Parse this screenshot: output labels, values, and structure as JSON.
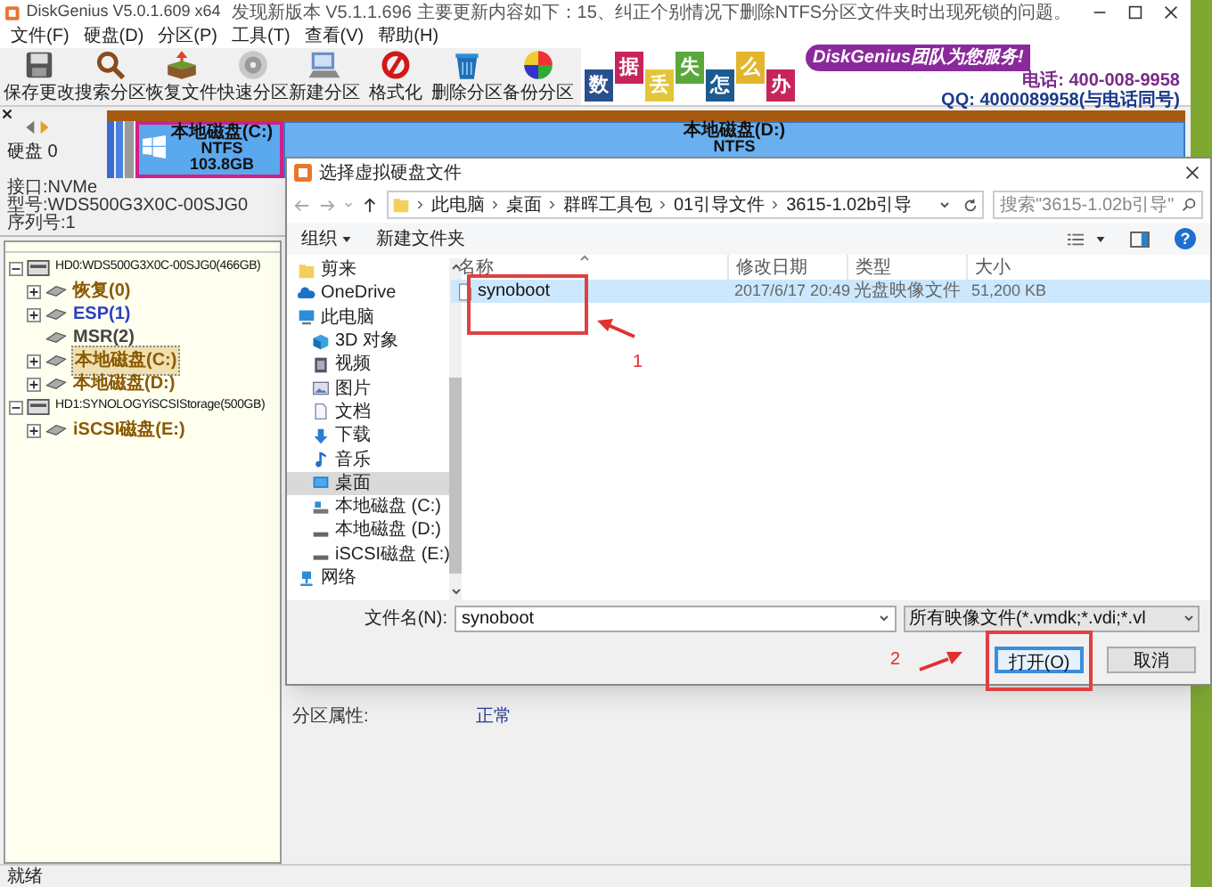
{
  "window": {
    "title": "DiskGenius V5.0.1.609 x64",
    "update_notice": "发现新版本 V5.1.1.696 主要更新内容如下：15、纠正个别情况下删除NTFS分区文件夹时出现死锁的问题。"
  },
  "menu": [
    "文件(F)",
    "硬盘(D)",
    "分区(P)",
    "工具(T)",
    "查看(V)",
    "帮助(H)"
  ],
  "toolbar": [
    {
      "label": "保存更改",
      "kind": "save"
    },
    {
      "label": "搜索分区",
      "kind": "search"
    },
    {
      "label": "恢复文件",
      "kind": "recover"
    },
    {
      "label": "快速分区",
      "kind": "quick"
    },
    {
      "label": "新建分区",
      "kind": "new"
    },
    {
      "label": "格式化",
      "kind": "format"
    },
    {
      "label": "删除分区",
      "kind": "delete"
    },
    {
      "label": "备份分区",
      "kind": "backup"
    }
  ],
  "ad": {
    "tiles": [
      {
        "text": "数",
        "color": "#2a4f8f"
      },
      {
        "text": "据",
        "color": "#c8245c"
      },
      {
        "text": "丢",
        "color": "#e2c63a"
      },
      {
        "text": "失",
        "color": "#5aa83c"
      },
      {
        "text": "怎",
        "color": "#1c5a8f"
      },
      {
        "text": "么",
        "color": "#e3b52d"
      },
      {
        "text": "办",
        "color": "#c8245c"
      }
    ],
    "slogan": "DiskGenius团队为您服务!",
    "phone": "电话: 400-008-9958",
    "qq": "QQ: 4000089958(与电话同号)"
  },
  "disk_map": {
    "disk_label": "硬盘 0",
    "partitions": [
      {
        "name": "本地磁盘(C:)",
        "fs": "NTFS",
        "size": "103.8GB",
        "selected": true
      },
      {
        "name": "本地磁盘(D:)",
        "fs": "NTFS",
        "selected": false
      }
    ]
  },
  "disk_info": [
    "接口:NVMe",
    "型号:WDS500G3X0C-00SJG0",
    "序列号:1"
  ],
  "tree": [
    {
      "label": "HD0:WDS500G3X0C-00SJG0(466GB)",
      "kind": "disk",
      "expanded": true,
      "selected": false,
      "children": [
        {
          "label": "恢复(0)",
          "kind": "partition",
          "expanded": false,
          "selected": false,
          "color": "#8a5a00"
        },
        {
          "label": "ESP(1)",
          "kind": "partition",
          "expanded": false,
          "selected": false,
          "color": "#2b3fc8"
        },
        {
          "label": "MSR(2)",
          "kind": "partition",
          "selected": false,
          "color": "#444444"
        },
        {
          "label": "本地磁盘(C:)",
          "kind": "partition",
          "expanded": false,
          "selected": true,
          "color": "#8a5a00"
        },
        {
          "label": "本地磁盘(D:)",
          "kind": "partition",
          "expanded": false,
          "selected": false,
          "color": "#8a5a00"
        }
      ]
    },
    {
      "label": "HD1:SYNOLOGYiSCSIStorage(500GB)",
      "kind": "disk",
      "expanded": true,
      "selected": false,
      "children": [
        {
          "label": "iSCSI磁盘(E:)",
          "kind": "partition",
          "expanded": false,
          "selected": false,
          "color": "#8a5a00"
        }
      ]
    }
  ],
  "partition_properties": {
    "label": "分区属性:",
    "value": "正常"
  },
  "dialog": {
    "title": "选择虚拟硬盘文件",
    "breadcrumb": [
      "此电脑",
      "桌面",
      "群晖工具包",
      "01引导文件",
      "3615-1.02b引导"
    ],
    "search_placeholder": "搜索\"3615-1.02b引导\"",
    "organize": "组织",
    "new_folder": "新建文件夹",
    "help": "?",
    "nav": [
      {
        "label": "剪来",
        "kind": "folder",
        "selected": false
      },
      {
        "label": "OneDrive",
        "kind": "cloud",
        "selected": false
      },
      {
        "label": "此电脑",
        "kind": "computer",
        "selected": false
      },
      {
        "label": "3D 对象",
        "kind": "cube",
        "selected": false
      },
      {
        "label": "视频",
        "kind": "video",
        "selected": false
      },
      {
        "label": "图片",
        "kind": "picture",
        "selected": false
      },
      {
        "label": "文档",
        "kind": "document",
        "selected": false
      },
      {
        "label": "下载",
        "kind": "download",
        "selected": false
      },
      {
        "label": "音乐",
        "kind": "music",
        "selected": false
      },
      {
        "label": "桌面",
        "kind": "desktop",
        "selected": true
      },
      {
        "label": "本地磁盘 (C:)",
        "kind": "system-drive",
        "selected": false
      },
      {
        "label": "本地磁盘 (D:)",
        "kind": "drive",
        "selected": false
      },
      {
        "label": "iSCSI磁盘 (E:)",
        "kind": "drive",
        "selected": false
      },
      {
        "label": "网络",
        "kind": "network",
        "selected": false
      }
    ],
    "columns": [
      "名称",
      "修改日期",
      "类型",
      "大小"
    ],
    "files": [
      {
        "name": "synoboot",
        "modified": "2017/6/17 20:49",
        "type": "光盘映像文件",
        "size": "51,200 KB",
        "selected": true
      }
    ],
    "filename_label": "文件名(N):",
    "filename": "synoboot",
    "filter": "所有映像文件(*.vmdk;*.vdi;*.vl",
    "buttons": [
      {
        "label": "打开(O)",
        "default": true
      },
      {
        "label": "取消",
        "default": false
      }
    ]
  },
  "annotations": [
    {
      "label": "1"
    },
    {
      "label": "2"
    }
  ],
  "status_bar": "就绪"
}
